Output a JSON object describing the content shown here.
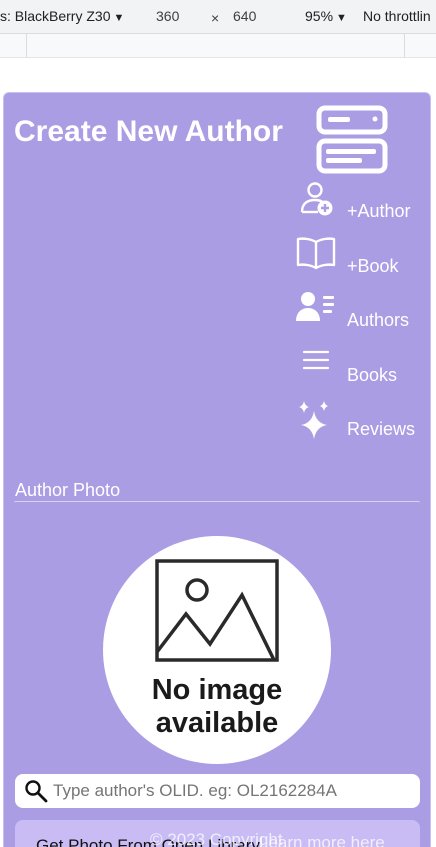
{
  "devtools": {
    "device_label": "s: BlackBerry Z30",
    "caret": "▼",
    "width": "360",
    "times": "×",
    "height": "640",
    "zoom": "95%",
    "throttle": "No throttlin"
  },
  "page": {
    "title": "Create New Author",
    "nav": [
      {
        "label": "+Author",
        "icon": "user-add-icon"
      },
      {
        "label": "+Book",
        "icon": "open-book-icon"
      },
      {
        "label": "Authors",
        "icon": "user-list-icon"
      },
      {
        "label": "Books",
        "icon": "menu-lines-icon"
      },
      {
        "label": "Reviews",
        "icon": "sparkles-icon"
      }
    ],
    "photo_section_label": "Author Photo",
    "no_image_line1": "No image",
    "no_image_line2": "available",
    "search_placeholder": "Type author's OLID. eg: OL2162284A",
    "get_photo_button": "Get Photo From Open Library",
    "footer_copyright": "© 2023 Copyright",
    "footer_link": "Learn more here"
  },
  "colors": {
    "card_background": "#aa9de3",
    "button_background": "#c9bcf5",
    "text_on_card": "#ffffff"
  }
}
